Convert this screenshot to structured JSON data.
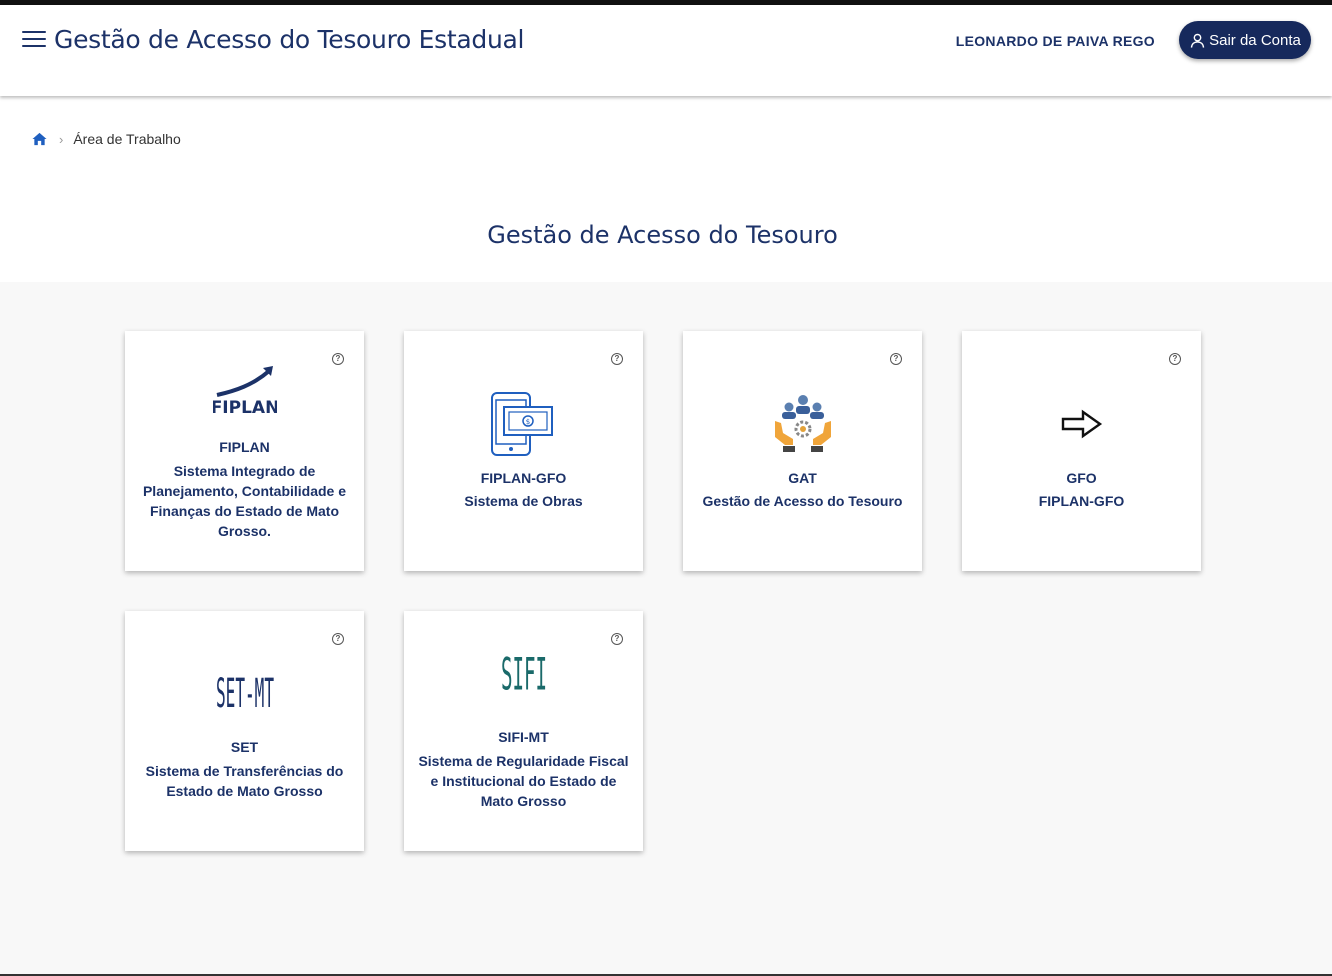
{
  "header": {
    "title": "Gestão de Acesso do Tesouro Estadual",
    "user": "LEONARDO DE PAIVA REGO",
    "logout_label": "Sair da Conta"
  },
  "breadcrumb": {
    "current": "Área de Trabalho"
  },
  "page": {
    "heading": "Gestão de Acesso do Tesouro"
  },
  "cards": [
    {
      "logo_text": "FIPLAN",
      "title": "FIPLAN",
      "description": "Sistema Integrado de Planejamento, Contabilidade e Finanças do Estado de Mato Grosso."
    },
    {
      "title": "FIPLAN-GFO",
      "description": "Sistema de Obras"
    },
    {
      "title": "GAT",
      "description": "Gestão de Acesso do Tesouro"
    },
    {
      "title": "GFO",
      "description": "FIPLAN-GFO"
    },
    {
      "logo_text": "SET-MT",
      "title": "SET",
      "description": "Sistema de Transferências do Estado de Mato Grosso"
    },
    {
      "logo_text": "SIFI",
      "title": "SIFI-MT",
      "description": "Sistema de Regularidade Fiscal e Institucional do Estado de Mato Grosso"
    }
  ],
  "help_symbol": "?",
  "colors": {
    "primary": "#1c3268",
    "button": "#16295c",
    "background": "#f8f8f8",
    "sifi": "#1a6a6a"
  }
}
